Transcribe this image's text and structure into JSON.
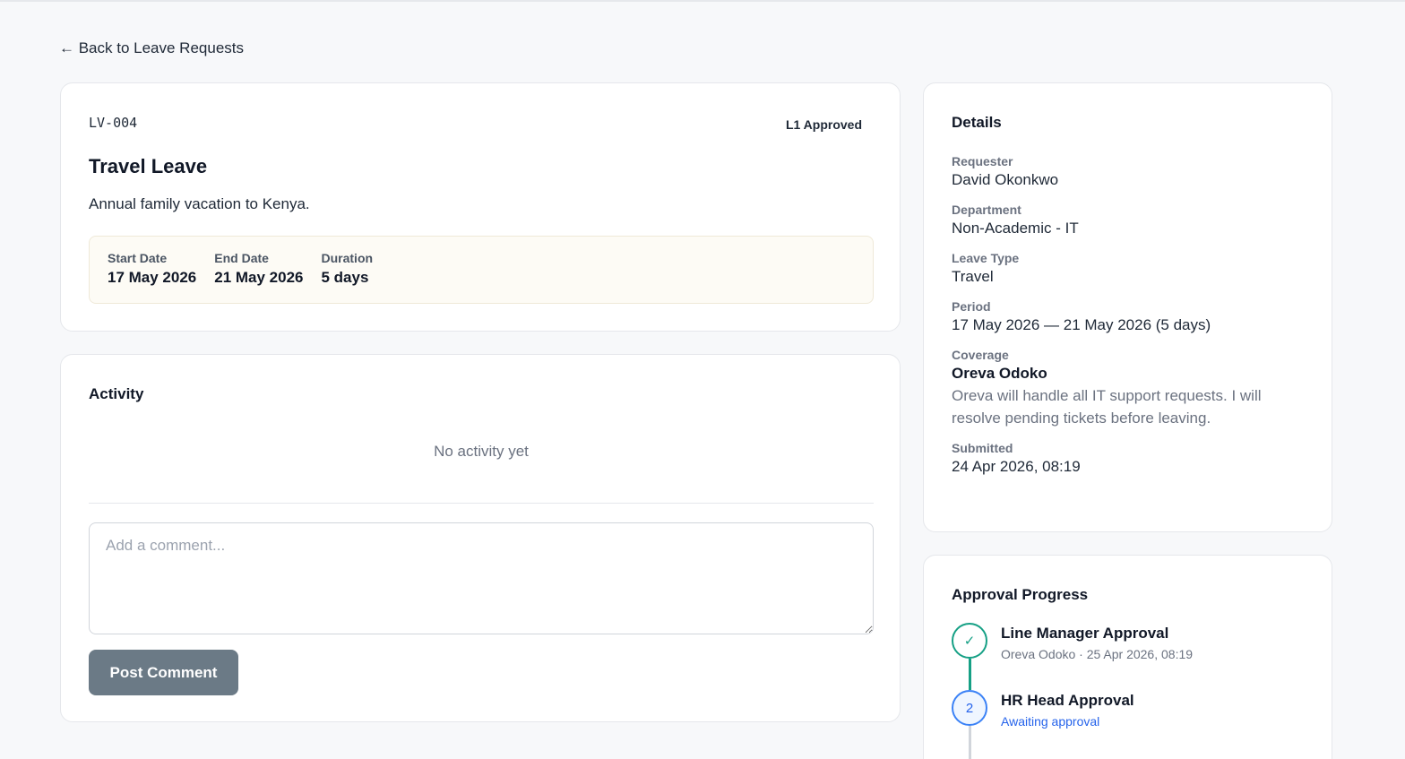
{
  "back_link": "← Back to Leave Requests",
  "summary": {
    "ref_id": "LV-004",
    "status": "L1 Approved",
    "title": "Travel Leave",
    "description": "Annual family vacation to Kenya.",
    "dates": [
      {
        "label": "Start Date",
        "value": "17 May 2026"
      },
      {
        "label": "End Date",
        "value": "21 May 2026"
      },
      {
        "label": "Duration",
        "value": "5 days"
      }
    ]
  },
  "activity": {
    "title": "Activity",
    "empty": "No activity yet",
    "comment_placeholder": "Add a comment...",
    "post_button": "Post Comment"
  },
  "details": {
    "title": "Details",
    "requester_label": "Requester",
    "requester": "David Okonkwo",
    "department_label": "Department",
    "department": "Non-Academic - IT",
    "leave_type_label": "Leave Type",
    "leave_type": "Travel",
    "period_label": "Period",
    "period": "17 May 2026 — 21 May 2026 (5 days)",
    "coverage_label": "Coverage",
    "coverage_name": "Oreva Odoko",
    "coverage_note": "Oreva will handle all IT support requests. I will resolve pending tickets before leaving.",
    "submitted_label": "Submitted",
    "submitted": "24 Apr 2026, 08:19"
  },
  "approval": {
    "title": "Approval Progress",
    "steps": [
      {
        "marker": "✓",
        "title": "Line Manager Approval",
        "sub": "Oreva Odoko · 25 Apr 2026, 08:19",
        "state": "done"
      },
      {
        "marker": "2",
        "title": "HR Head Approval",
        "sub": "Awaiting approval",
        "state": "pending"
      }
    ]
  },
  "colors": {
    "done": "#16a085",
    "pending": "#2563eb",
    "button": "#6b7a86"
  }
}
